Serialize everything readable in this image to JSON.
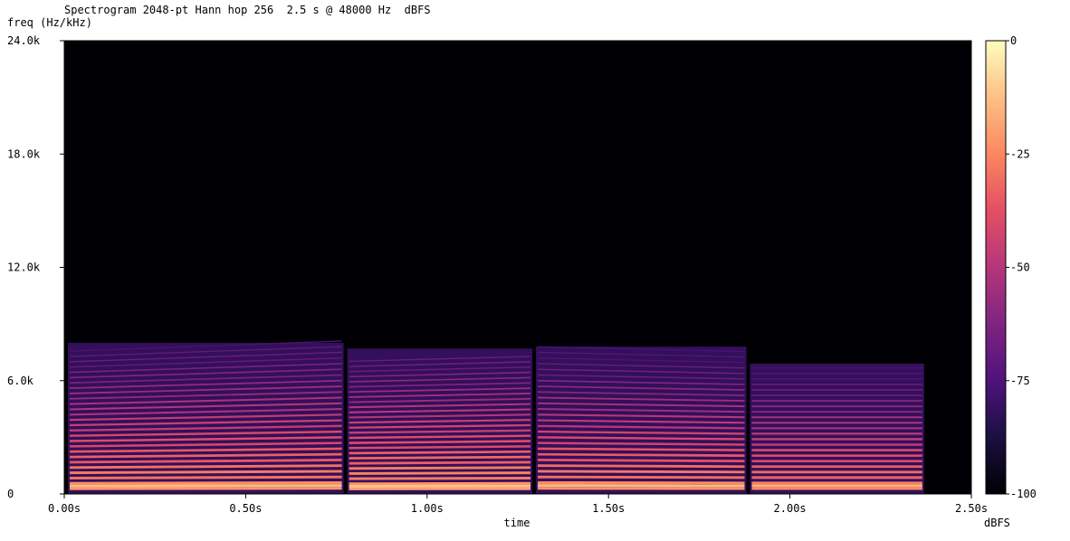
{
  "chart_data": {
    "type": "heatmap",
    "title": "Spectrogram 2048-pt Hann hop 256  2.5 s @ 48000 Hz  dBFS",
    "ylabel": "freq (Hz/kHz)",
    "xlabel": "time",
    "colorbar_label": "dBFS",
    "x_ticks": [
      {
        "value": 0.0,
        "label": "0.00s"
      },
      {
        "value": 0.5,
        "label": "0.50s"
      },
      {
        "value": 1.0,
        "label": "1.00s"
      },
      {
        "value": 1.5,
        "label": "1.50s"
      },
      {
        "value": 2.0,
        "label": "2.00s"
      },
      {
        "value": 2.5,
        "label": "2.50s"
      }
    ],
    "y_ticks": [
      {
        "value": 0,
        "label": "0"
      },
      {
        "value": 6000,
        "label": "6.0k"
      },
      {
        "value": 12000,
        "label": "12.0k"
      },
      {
        "value": 18000,
        "label": "18.0k"
      },
      {
        "value": 24000,
        "label": "24.0k"
      }
    ],
    "colorbar_ticks": [
      {
        "value": 0,
        "label": "0"
      },
      {
        "value": -25,
        "label": "-25"
      },
      {
        "value": -50,
        "label": "-50"
      },
      {
        "value": -75,
        "label": "-75"
      },
      {
        "value": -100,
        "label": "-100"
      }
    ],
    "xlim": [
      0,
      2.5
    ],
    "ylim": [
      0,
      24000
    ],
    "clim": [
      -100,
      0
    ],
    "colormap": "magma",
    "background_color": "#000004",
    "segments": [
      {
        "start": 0.01,
        "end": 0.77,
        "top_hz": 8000,
        "f0_start": 280,
        "f0_end": 300,
        "harmonic_spacing": 290,
        "peak_db": -20
      },
      {
        "start": 0.78,
        "end": 1.29,
        "top_hz": 7700,
        "f0_start": 270,
        "f0_end": 280,
        "harmonic_spacing": 290,
        "peak_db": -18
      },
      {
        "start": 1.3,
        "end": 1.88,
        "top_hz": 7800,
        "f0_start": 300,
        "f0_end": 290,
        "harmonic_spacing": 290,
        "peak_db": -20
      },
      {
        "start": 1.89,
        "end": 2.37,
        "top_hz": 6900,
        "f0_start": 290,
        "f0_end": 290,
        "harmonic_spacing": 290,
        "peak_db": -22
      }
    ]
  }
}
